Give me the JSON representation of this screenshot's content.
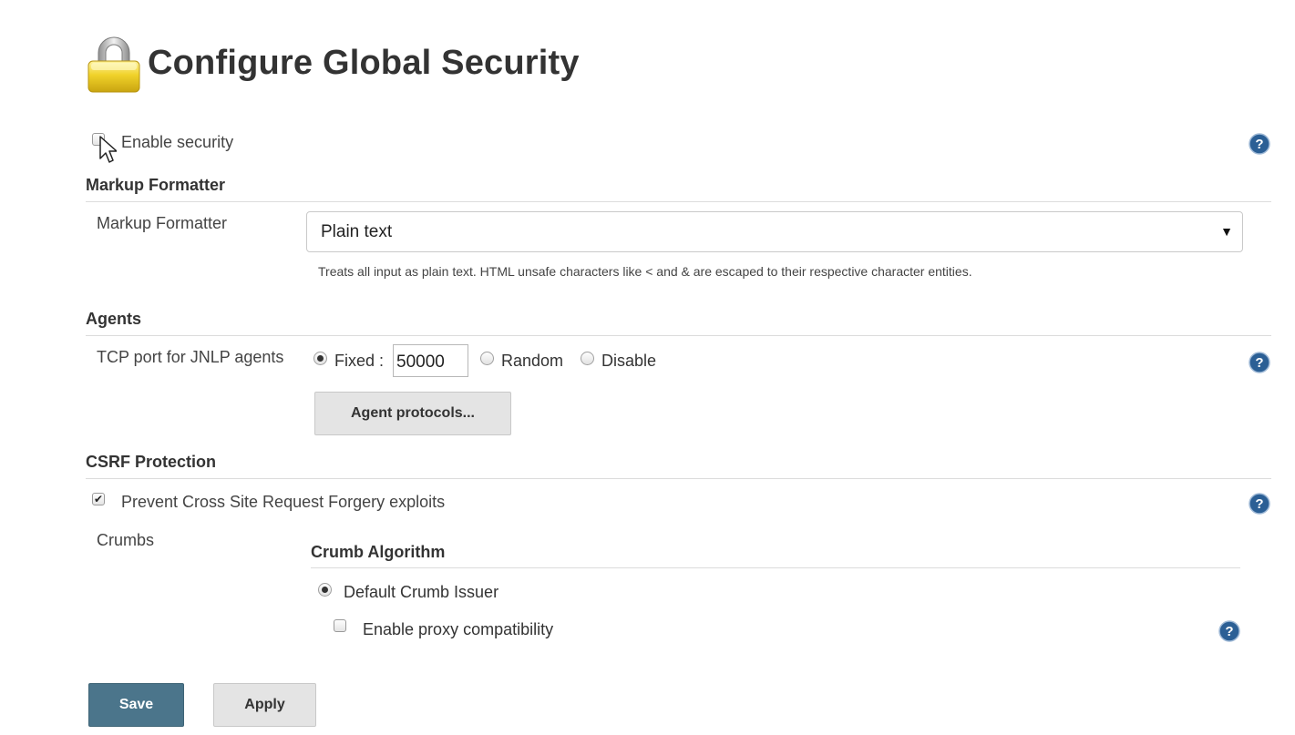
{
  "page": {
    "title": "Configure Global Security"
  },
  "enable_security": {
    "label": "Enable security",
    "checked": false
  },
  "markup_formatter": {
    "section_title": "Markup Formatter",
    "field_label": "Markup Formatter",
    "selected": "Plain text",
    "description": "Treats all input as plain text. HTML unsafe characters like < and & are escaped to their respective character entities."
  },
  "agents": {
    "section_title": "Agents",
    "tcp_label": "TCP port for JNLP agents",
    "fixed_label": "Fixed :",
    "port_value": "50000",
    "random_label": "Random",
    "disable_label": "Disable",
    "selected_option": "Fixed",
    "protocols_button": "Agent protocols..."
  },
  "csrf": {
    "section_title": "CSRF Protection",
    "prevent_label": "Prevent Cross Site Request Forgery exploits",
    "prevent_checked": true,
    "crumbs_label": "Crumbs",
    "crumb_algorithm_title": "Crumb Algorithm",
    "default_issuer_label": "Default Crumb Issuer",
    "default_issuer_selected": true,
    "proxy_label": "Enable proxy compatibility",
    "proxy_checked": false
  },
  "buttons": {
    "save": "Save",
    "apply": "Apply"
  },
  "colors": {
    "accent": "#4b758b",
    "help_icon": "#2b5f95",
    "lock": "#e6c21a"
  },
  "icons": {
    "page_icon": "lock-icon",
    "help": "help-icon",
    "cursor": "mouse-cursor-icon"
  }
}
